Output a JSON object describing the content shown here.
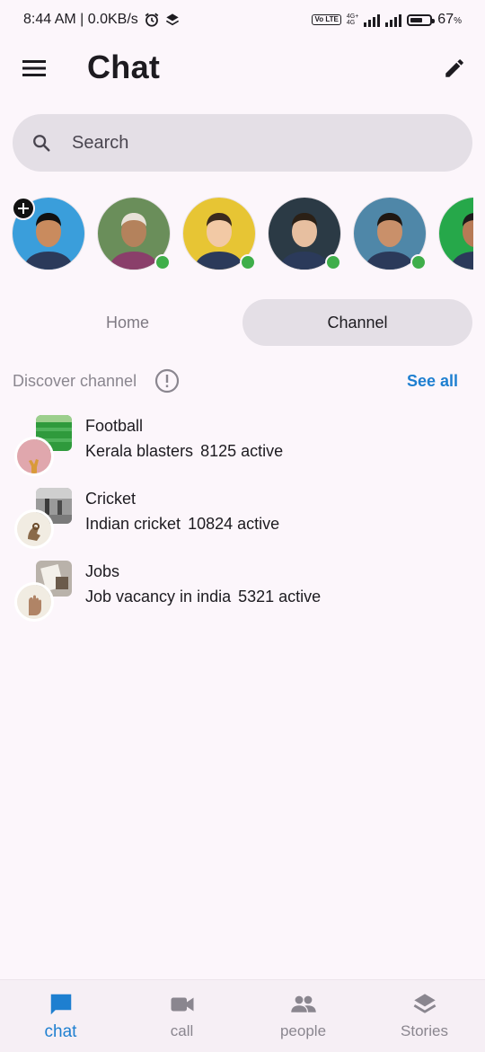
{
  "status_bar": {
    "time_text": "8:44 AM | 0.0KB/s",
    "volte": "Vo LTE",
    "net_type_top": "4G+",
    "net_type_bottom": "4G",
    "battery_percent": "67",
    "battery_suffix": "%",
    "battery_level": 0.67
  },
  "header": {
    "title": "Chat",
    "menu_icon": "menu-icon",
    "edit_icon": "edit-pencil-icon"
  },
  "search": {
    "placeholder": "Search"
  },
  "stories": [
    {
      "name": "my-story",
      "add": true,
      "online": false,
      "bg": "#3A9EDB"
    },
    {
      "name": "contact-1",
      "add": false,
      "online": true,
      "bg": "#6A8E5A"
    },
    {
      "name": "contact-2",
      "add": false,
      "online": true,
      "bg": "#E7C534"
    },
    {
      "name": "contact-3",
      "add": false,
      "online": true,
      "bg": "#2B3A45"
    },
    {
      "name": "contact-4",
      "add": false,
      "online": true,
      "bg": "#4F87A8"
    },
    {
      "name": "contact-5",
      "add": false,
      "online": false,
      "bg": "#26A84A"
    }
  ],
  "segments": {
    "home": "Home",
    "channel": "Channel",
    "selected": "Channel"
  },
  "discover": {
    "label": "Discover channel",
    "see_all": "See all"
  },
  "channels": [
    {
      "name": "Football",
      "subtitle": "Kerala blasters",
      "active": "8125 active"
    },
    {
      "name": "Cricket",
      "subtitle": "Indian cricket",
      "active": "10824 active"
    },
    {
      "name": "Jobs",
      "subtitle": "Job vacancy in india",
      "active": "5321 active"
    }
  ],
  "bottom_nav": [
    {
      "label": "chat",
      "icon": "chat-bubble-icon",
      "active": true
    },
    {
      "label": "call",
      "icon": "video-camera-icon",
      "active": false
    },
    {
      "label": "people",
      "icon": "people-icon",
      "active": false
    },
    {
      "label": "Stories",
      "icon": "layers-icon",
      "active": false
    }
  ],
  "colors": {
    "accent": "#1e7fd0",
    "background": "#FCF6FB",
    "surface_variant": "#E4DFE6",
    "online": "#3fae4a"
  }
}
